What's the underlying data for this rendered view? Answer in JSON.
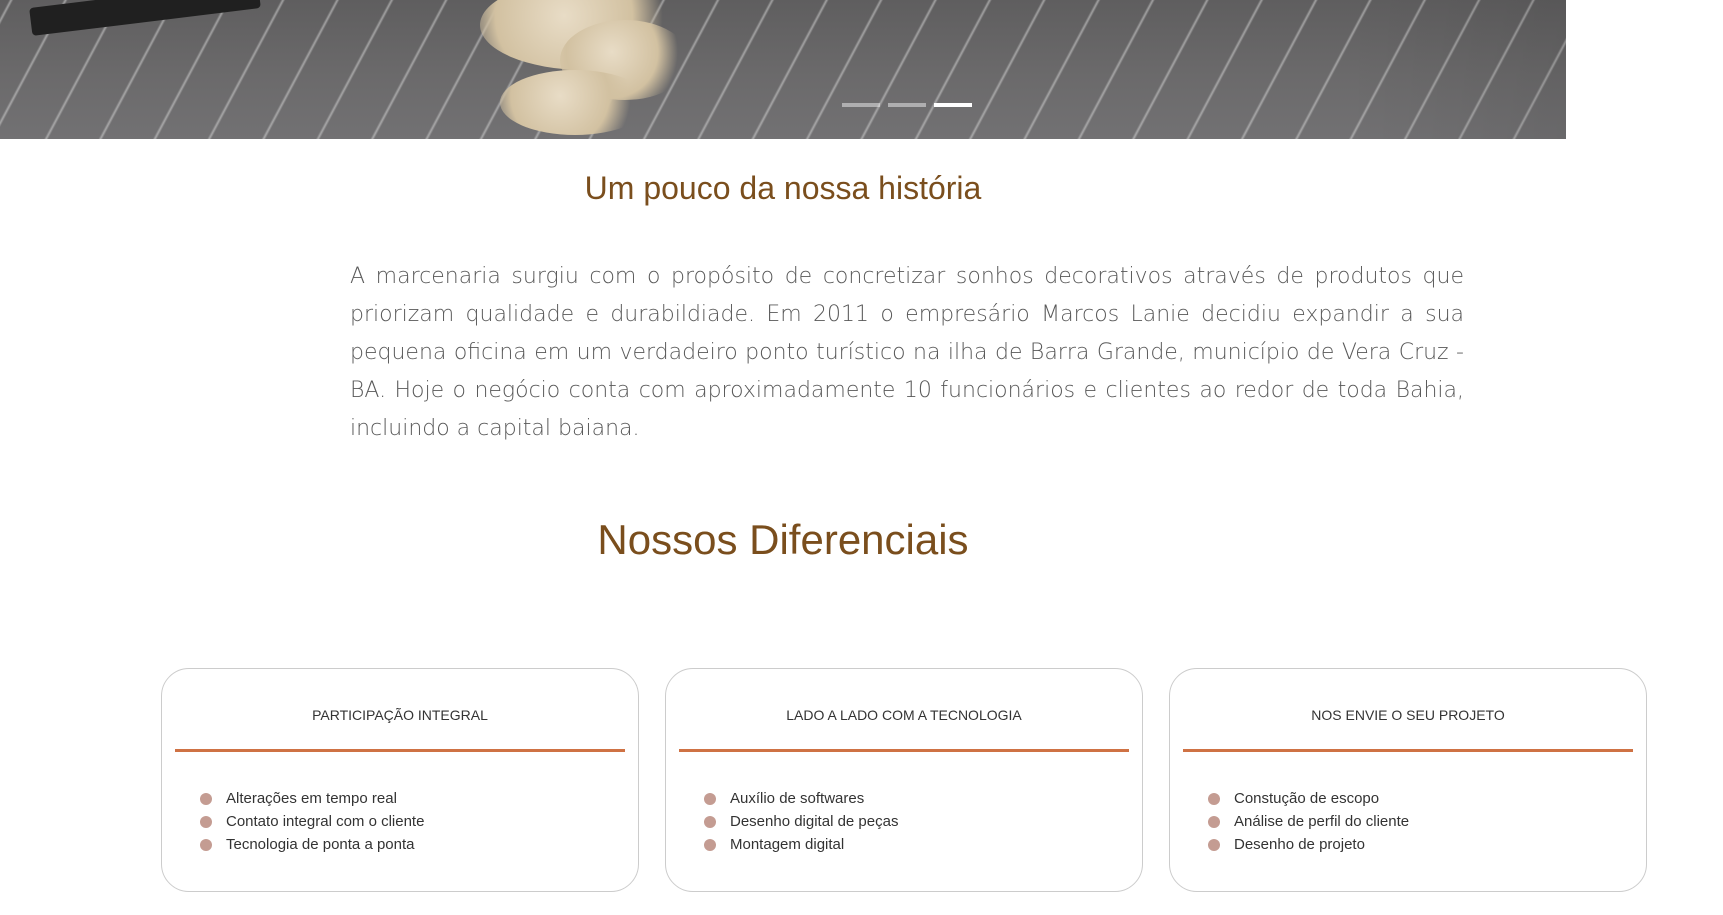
{
  "hero": {
    "slide_count": 3,
    "active_slide": 3
  },
  "history": {
    "title": "Um pouco da nossa história",
    "text": "A marcenaria surgiu com o propósito de concretizar sonhos decorativos através de produtos que priorizam qualidade e durabildiade. Em 2011 o empresário Marcos Lanie decidiu expandir a sua pequena oficina em um verdadeiro ponto turístico na ilha de Barra Grande, município de Vera Cruz - BA. Hoje o negócio conta com aproximadamente 10 funcionários e clientes ao redor de toda Bahia, incluindo a capital baiana."
  },
  "differentials": {
    "title": "Nossos Diferenciais",
    "cards": [
      {
        "title": "PARTICIPAÇÃO INTEGRAL",
        "items": [
          "Alterações em tempo real",
          "Contato integral com o cliente",
          "Tecnologia de ponta a ponta"
        ]
      },
      {
        "title": "LADO A LADO COM A TECNOLOGIA",
        "items": [
          "Auxílio de softwares",
          "Desenho digital de peças",
          "Montagem digital"
        ]
      },
      {
        "title": "NOS ENVIE O SEU PROJETO",
        "items": [
          "Constução de escopo",
          "Análise de perfil do cliente",
          "Desenho de projeto"
        ]
      }
    ]
  },
  "colors": {
    "heading": "#7a4e1d",
    "divider": "#cf7244",
    "bullet": "#c49c92"
  }
}
